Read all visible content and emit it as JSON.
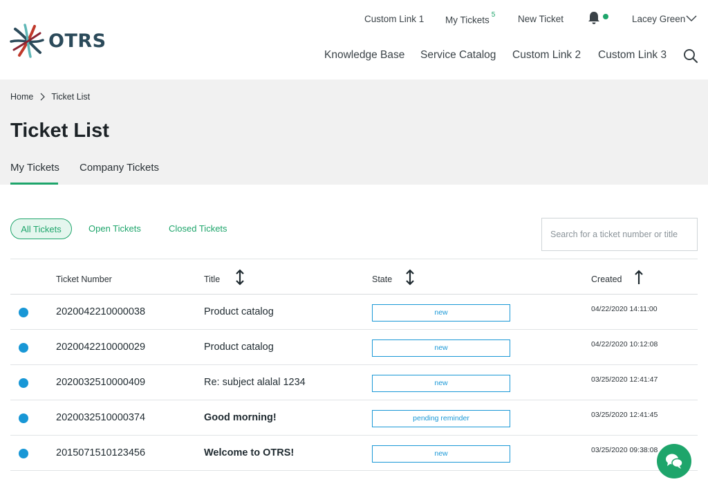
{
  "brand": {
    "name": "OTRS"
  },
  "topnav": {
    "custom_link_1": "Custom Link 1",
    "my_tickets": "My Tickets",
    "my_tickets_count": "5",
    "new_ticket": "New Ticket",
    "user_name": "Lacey Green"
  },
  "mainnav": {
    "items": [
      "Knowledge Base",
      "Service Catalog",
      "Custom Link 2",
      "Custom Link 3"
    ]
  },
  "breadcrumb": {
    "home": "Home",
    "current": "Ticket List"
  },
  "page": {
    "title": "Ticket List"
  },
  "tabs": [
    "My Tickets",
    "Company Tickets"
  ],
  "filters": [
    "All Tickets",
    "Open Tickets",
    "Closed Tickets"
  ],
  "search": {
    "placeholder": "Search for a ticket number or title"
  },
  "table": {
    "headers": {
      "number": "Ticket Number",
      "title": "Title",
      "state": "State",
      "created": "Created"
    },
    "rows": [
      {
        "number": "2020042210000038",
        "title": "Product catalog",
        "state": "new",
        "created": "04/22/2020 14:11:00"
      },
      {
        "number": "2020042210000029",
        "title": "Product catalog",
        "state": "new",
        "created": "04/22/2020 10:12:08"
      },
      {
        "number": "2020032510000409",
        "title": "Re: subject alalal 1234",
        "state": "new",
        "created": "03/25/2020 12:41:47"
      },
      {
        "number": "2020032510000374",
        "title": "Good morning!",
        "state": "pending reminder",
        "created": "03/25/2020 12:41:45"
      },
      {
        "number": "2015071510123456",
        "title": "Welcome to OTRS!",
        "state": "new",
        "created": "03/25/2020 09:38:08"
      }
    ]
  },
  "colors": {
    "accent": "#1ea56b",
    "state_blue": "#1897d6",
    "brand_dark": "#2b4a5a"
  }
}
